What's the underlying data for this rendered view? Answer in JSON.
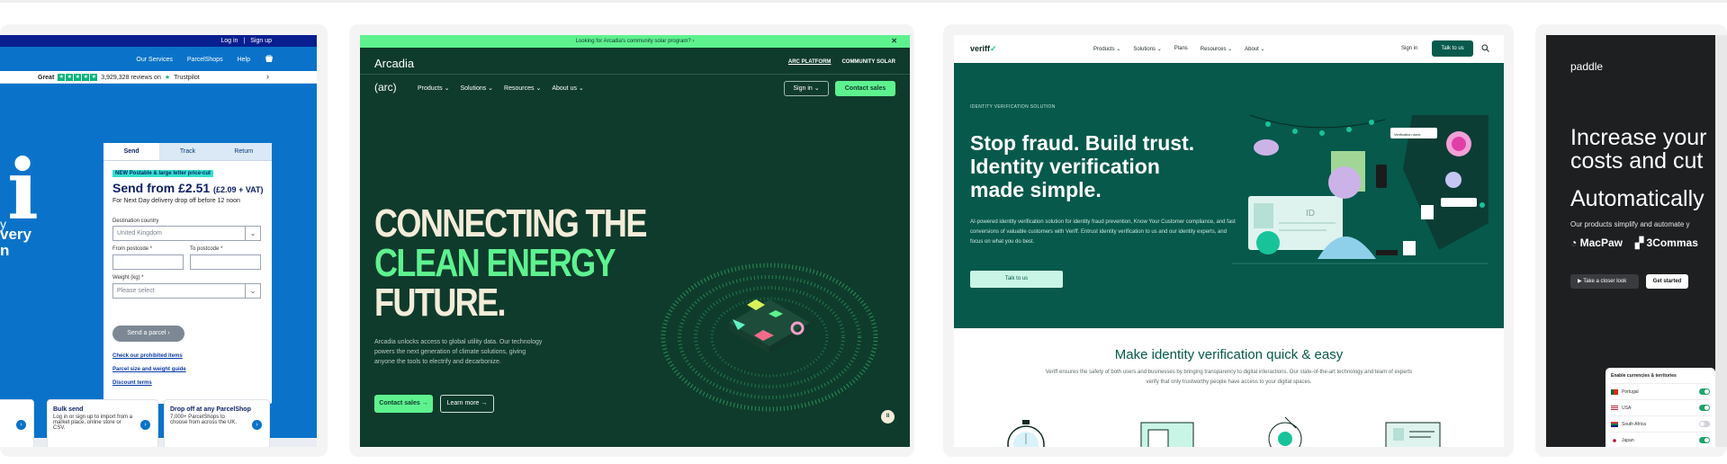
{
  "card1": {
    "topbar": {
      "login": "Log in",
      "separator": "|",
      "signup": "Sign up"
    },
    "nav": {
      "items": [
        "Our Services",
        "ParcelShops",
        "Help"
      ]
    },
    "trust": {
      "rating": "Great",
      "reviews": "3,929,328 reviews on",
      "brand": "Trustpilot"
    },
    "hero_text_line1": "very",
    "hero_text_line2": "n",
    "hero_prefix": "y",
    "form": {
      "tabs": [
        "Send",
        "Track",
        "Return"
      ],
      "badge": "NEW Postable & large letter price-cut",
      "price": "Send from £2.51",
      "price_vat": "(£2.09 + VAT)",
      "note": "For Next Day delivery drop off before 12 noon",
      "destination_label": "Destination country",
      "destination_value": "United Kingdom",
      "from_label": "From postcode *",
      "to_label": "To postcode *",
      "weight_label": "Weight (kg) *",
      "weight_placeholder": "Please select",
      "submit": "Send a parcel",
      "links": [
        "Check our prohibited items",
        "Parcel size and weight guide",
        "Discount terms"
      ]
    },
    "features": [
      {
        "title": "Bulk send",
        "text": "Log in or sign up to import from a market place, online store or CSV."
      },
      {
        "title": "Drop off at any ParcelShop",
        "text": "7,000+ ParcelShops to choose from across the UK."
      }
    ]
  },
  "card2": {
    "banner": "Looking for Arcadia's community solar program? ›",
    "close": "✕",
    "logo": "Arcadia",
    "platform": [
      "ARC PLATFORM",
      "COMMUNITY SOLAR"
    ],
    "arc_logo": "(arc)",
    "nav": [
      "Products ⌄",
      "Solutions ⌄",
      "Resources ⌄",
      "About us ⌄"
    ],
    "signin": "Sign in ⌄",
    "contact": "Contact sales",
    "headline": [
      "CONNECTING THE",
      "CLEAN ENERGY",
      "FUTURE."
    ],
    "paragraph": "Arcadia unlocks access to global utility data. Our technology powers the next generation of climate solutions, giving anyone the tools to electrify and decarbonize.",
    "cta_primary": "Contact sales →",
    "cta_secondary": "Learn more →",
    "pause": "II"
  },
  "card3": {
    "logo": "veriff",
    "logo_mark": "✓",
    "menu": [
      "Products ⌄",
      "Solutions ⌄",
      "Plans",
      "Resources ⌄",
      "About ⌄"
    ],
    "signin": "Sign in",
    "talk": "Talk to us",
    "eyebrow": "IDENTITY VERIFICATION SOLUTION",
    "headline": [
      "Stop fraud. Build trust.",
      "Identity verification",
      "made simple."
    ],
    "paragraph": "AI-powered identity verification solution for identity fraud prevention, Know Your Customer compliance, and fast conversions of valuable customers with Veriff. Entrust identity verification to us and our identity experts, and focus on what you do best.",
    "cta": "Talk to us",
    "section_title": "Make identity verification quick & easy",
    "section_text": "Veriff ensures the safety of both users and businesses by bringing transparency to digital interactions. Our state-of-the-art technology and team of experts verify that only trustworthy people have access to your digital spaces.",
    "id_label": "ID",
    "badge": "Verification done"
  },
  "card4": {
    "logo": "paddle",
    "headline": [
      "Increase your",
      "costs and cut"
    ],
    "headline2": "Automatically",
    "subtitle": "Our products simplify and automate y",
    "logos": [
      "MacPaw",
      "3Commas"
    ],
    "btn_secondary": "Take a closer look",
    "btn_primary": "Get started",
    "panel_title": "Enable currencies & territories",
    "rows": [
      {
        "name": "Portugal",
        "on": true
      },
      {
        "name": "USA",
        "on": true
      },
      {
        "name": "South Africa",
        "on": false
      },
      {
        "name": "Japan",
        "on": true
      }
    ]
  }
}
